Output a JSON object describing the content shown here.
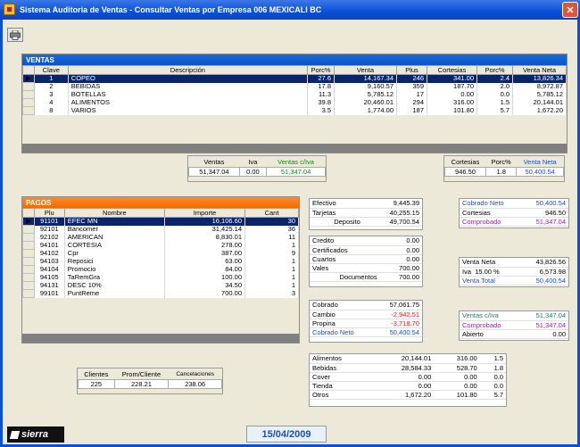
{
  "window": {
    "title": "Sistema Auditoria de Ventas - Consultar Ventas por Empresa    006 MEXICALI BC"
  },
  "ventas": {
    "header": "VENTAS",
    "columns": [
      "Clave",
      "Descripción",
      "Porc%",
      "Venta",
      "Plus",
      "Cortesias",
      "Porc%",
      "Venta Neta"
    ],
    "rows": [
      [
        "1",
        "COPEO",
        "27.6",
        "14,167.34",
        "246",
        "341.00",
        "2.4",
        "13,826.34"
      ],
      [
        "2",
        "BEBIDAS",
        "17.8",
        "9,160.57",
        "359",
        "187.70",
        "2.0",
        "8,972.87"
      ],
      [
        "3",
        "BOTELLAS",
        "11.3",
        "5,785.12",
        "17",
        "0.00",
        "0.0",
        "5,785.12"
      ],
      [
        "4",
        "ALIMENTOS",
        "39.8",
        "20,460.01",
        "294",
        "316.00",
        "1.5",
        "20,144.01"
      ],
      [
        "8",
        "VARIOS",
        "3.5",
        "1,774.00",
        "187",
        "101.80",
        "5.7",
        "1,672.20"
      ]
    ],
    "totals": {
      "ventas_label": "Ventas",
      "iva_label": "Iva",
      "ventas_civa_label": "Ventas c/Iva",
      "ventas": "51,347.04",
      "iva": "0.00",
      "ventas_civa": "51,347.04"
    },
    "totals2": {
      "cortesias_label": "Cortesias",
      "porc_label": "Porc%",
      "venta_neta_label": "Venta Neta",
      "cortesias": "946.50",
      "porc": "1.8",
      "venta_neta": "50,400.54"
    }
  },
  "pagos": {
    "header": "PAGOS",
    "columns": [
      "Plu",
      "Nombre",
      "Importe",
      "Cant"
    ],
    "rows": [
      [
        "91101",
        "EFEC MN",
        "16,106.60",
        "30"
      ],
      [
        "92101",
        "Bancomer",
        "31,425.14",
        "36"
      ],
      [
        "92102",
        "AMERICAN",
        "8,830.01",
        "11"
      ],
      [
        "94101",
        "CORTESIA",
        "278.00",
        "1"
      ],
      [
        "94102",
        "Cpr",
        "387.00",
        "9"
      ],
      [
        "94103",
        "Reposici",
        "63.00",
        "1"
      ],
      [
        "94104",
        "Promocio",
        "84.00",
        "1"
      ],
      [
        "94105",
        "TaRemGra",
        "100.00",
        "1"
      ],
      [
        "94131",
        "DESC 10%",
        "34.50",
        "1"
      ],
      [
        "99101",
        "PuntReme",
        "700.00",
        "3"
      ]
    ]
  },
  "clientes": {
    "clientes_label": "Clientes",
    "prom_label": "Prom/Cliente",
    "cancel_label": "Cancelaciones",
    "clientes": "225",
    "prom": "228.21",
    "cancel": "238.06"
  },
  "efectivo": [
    [
      "Efectivo",
      "9,445.39"
    ],
    [
      "Tarjetas",
      "40,255.15"
    ],
    [
      "Deposito",
      "49,700.54"
    ]
  ],
  "credito": [
    [
      "Credito",
      "0.00"
    ],
    [
      "Certificados",
      "0.00"
    ],
    [
      "Cuartos",
      "0.00"
    ],
    [
      "Vales",
      "700.00"
    ],
    [
      "Documentos",
      "700.00"
    ]
  ],
  "cobrado": [
    [
      "Cobrado",
      "57,061.75"
    ],
    [
      "Cambio",
      "-2,942.51"
    ],
    [
      "Propina",
      "-3,718.70"
    ],
    [
      "Cobrado Neto",
      "50,400.54"
    ]
  ],
  "cobrado_neto_box": [
    [
      "Cobrado Neto",
      "50,400.54"
    ],
    [
      "Cortesias",
      "946.50"
    ],
    [
      "Comprobado",
      "51,347.04"
    ]
  ],
  "venta_neta_box": {
    "venta_neta_label": "Venta Neta",
    "venta_neta": "43,826.56",
    "iva_label": "Iva",
    "iva_pct": "15.00 %",
    "iva": "6,573.98",
    "venta_total_label": "Venta Total",
    "venta_total": "50,400.54"
  },
  "ventas_civa_box": [
    [
      "Ventas c/Iva",
      "51,347.04"
    ],
    [
      "Comprobado",
      "51,347.04"
    ],
    [
      "Abierto",
      "0.00"
    ]
  ],
  "categorias": [
    [
      "Alimentos",
      "20,144.01",
      "316.00",
      "1.5"
    ],
    [
      "Bebidas",
      "28,584.33",
      "528.70",
      "1.8"
    ],
    [
      "Cover",
      "0.00",
      "0.00",
      "0.0"
    ],
    [
      "Tienda",
      "0.00",
      "0.00",
      "0.0"
    ],
    [
      "Otros",
      "1,672.20",
      "101.80",
      "5.7"
    ]
  ],
  "footer": {
    "logo": "sierra",
    "date": "15/04/2009"
  }
}
